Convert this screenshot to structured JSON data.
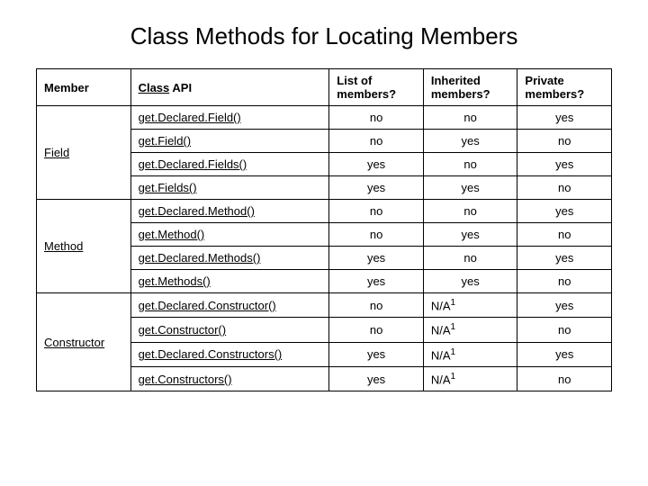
{
  "title": "Class Methods for Locating Members",
  "headers": {
    "member": "Member",
    "api_prefix": "Class",
    "api_suffix": " API",
    "list": "List of members?",
    "inherited": "Inherited members?",
    "private": "Private members?"
  },
  "groups": [
    {
      "name": "Field",
      "rows": [
        {
          "api": "get.Declared.Field()",
          "list": "no",
          "inherited": "no",
          "private": "yes"
        },
        {
          "api": "get.Field()",
          "list": "no",
          "inherited": "yes",
          "private": "no"
        },
        {
          "api": "get.Declared.Fields()",
          "list": "yes",
          "inherited": "no",
          "private": "yes"
        },
        {
          "api": "get.Fields()",
          "list": "yes",
          "inherited": "yes",
          "private": "no"
        }
      ]
    },
    {
      "name": "Method",
      "rows": [
        {
          "api": "get.Declared.Method()",
          "list": "no",
          "inherited": "no",
          "private": "yes"
        },
        {
          "api": "get.Method()",
          "list": "no",
          "inherited": "yes",
          "private": "no"
        },
        {
          "api": "get.Declared.Methods()",
          "list": "yes",
          "inherited": "no",
          "private": "yes"
        },
        {
          "api": "get.Methods()",
          "list": "yes",
          "inherited": "yes",
          "private": "no"
        }
      ]
    },
    {
      "name": "Constructor",
      "rows": [
        {
          "api": "get.Declared.Constructor()",
          "list": "no",
          "inherited": "N/A",
          "inherited_sup": "1",
          "private": "yes"
        },
        {
          "api": "get.Constructor()",
          "list": "no",
          "inherited": "N/A",
          "inherited_sup": "1",
          "private": "no"
        },
        {
          "api": "get.Declared.Constructors()",
          "list": "yes",
          "inherited": "N/A",
          "inherited_sup": "1",
          "private": "yes"
        },
        {
          "api": "get.Constructors()",
          "list": "yes",
          "inherited": "N/A",
          "inherited_sup": "1",
          "private": "no"
        }
      ]
    }
  ]
}
